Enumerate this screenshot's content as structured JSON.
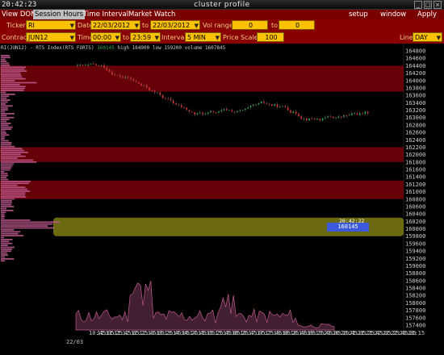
{
  "window": {
    "clock": "20:42:23",
    "title": "cluster profile",
    "controls": [
      "_",
      "□",
      "×"
    ]
  },
  "menu": {
    "tabs": [
      "View DOM",
      "Session Hours",
      "Time Interval",
      "Market Watch"
    ],
    "active_tab": "Session Hours",
    "right": [
      "setup",
      "window",
      "Apply"
    ]
  },
  "settings": {
    "ticker_label": "Ticker",
    "ticker_value": "RI",
    "date_label": "Date",
    "date_from": "22/03/2012",
    "date_to_label": "to",
    "date_to": "22/03/2012",
    "vol_range_label": "Vol range",
    "vol_from": "0",
    "vol_to_label": "to",
    "vol_to": "0",
    "contract_label": "Contract",
    "contract_value": "JUN12",
    "time_label": "Time",
    "time_from": "00:00",
    "time_to_label": "to",
    "time_to": "23:59",
    "interval_label": "Interval",
    "interval_value": "5 MIN",
    "price_scale_label": "Price Scale",
    "price_scale_value": "100",
    "line_label": "Line",
    "line_value": "DAY"
  },
  "chart_header": {
    "symbol": "RI(JUN12) - RTS Index(RTS FORTS)",
    "last": "160145",
    "high": "high 164900",
    "low": "low 159200",
    "volume": "volume 1607845"
  },
  "price_tag": {
    "time": "20:42:22",
    "price": "160145"
  },
  "date_label": "22/03",
  "colors": {
    "menu_bg": "#7a0000",
    "settings_bg": "#8a0000",
    "field_bg": "#fcc100",
    "band_red": "#6a0008",
    "band_yellow": "#6b6a10",
    "volume_fill": "#c05a90",
    "up_candle": "#2ea84a",
    "down_candle": "#d43030",
    "price_tag": "#3a5adb"
  },
  "chart_data": {
    "type": "candlestick",
    "y_ticks": [
      "164800",
      "164600",
      "164400",
      "164200",
      "164000",
      "163800",
      "163600",
      "163400",
      "163200",
      "163000",
      "162800",
      "162600",
      "162400",
      "162200",
      "162000",
      "161800",
      "161600",
      "161400",
      "161200",
      "161000",
      "160800",
      "160600",
      "160400",
      "160200",
      "160000",
      "159800",
      "159600",
      "159400",
      "159200",
      "159000",
      "158800",
      "158600",
      "158400",
      "158200",
      "158000",
      "157800",
      "157600",
      "157400"
    ],
    "x_ticks": [
      "10:45",
      "11:05",
      "11:25",
      "11:45",
      "12:05",
      "12:25",
      "12:45",
      "13:05",
      "13:25",
      "13:45",
      "14:05",
      "14:25",
      "14:45",
      "15:05",
      "15:25",
      "15:45",
      "16:05",
      "16:25",
      "16:45",
      "17:05",
      "17:25",
      "17:45",
      "18:05",
      "18:25",
      "18:45",
      "19:05",
      "19:25",
      "19:45",
      "20:05",
      "20:25",
      "20:45",
      "21:05",
      "21:25",
      "21:45",
      "22:05",
      "22:25",
      "22:45",
      "23:05",
      "23:15"
    ],
    "ylim": [
      157400,
      164900
    ],
    "high_volume_bands": [
      {
        "from": 163700,
        "to": 164400,
        "color": "red"
      },
      {
        "from": 161800,
        "to": 162200,
        "color": "red"
      },
      {
        "from": 160800,
        "to": 161300,
        "color": "red"
      },
      {
        "from": 159800,
        "to": 160300,
        "color": "yellow"
      }
    ],
    "last_price": 160145
  }
}
